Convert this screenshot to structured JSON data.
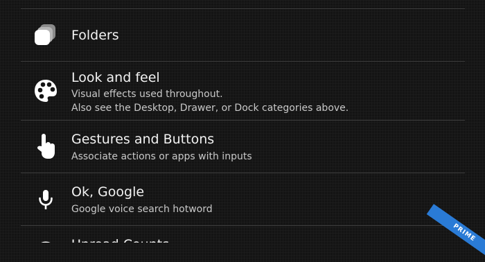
{
  "settings_list": {
    "items": [
      {
        "icon": "folders-icon",
        "title": "Folders",
        "subtitle_lines": []
      },
      {
        "icon": "palette-icon",
        "title": "Look and feel",
        "subtitle_lines": [
          "Visual effects used throughout.",
          "Also see the Desktop, Drawer, or Dock categories above."
        ]
      },
      {
        "icon": "gesture-hand-icon",
        "title": "Gestures and Buttons",
        "subtitle_lines": [
          "Associate actions or apps with inputs"
        ]
      },
      {
        "icon": "microphone-icon",
        "title": "Ok, Google",
        "subtitle_lines": [
          "Google voice search hotword"
        ]
      },
      {
        "icon": "unread-counts-icon",
        "title": "Unread Counts",
        "subtitle_lines": []
      }
    ]
  },
  "ribbon": {
    "label": "PRIME",
    "color": "#2a7bd6"
  }
}
